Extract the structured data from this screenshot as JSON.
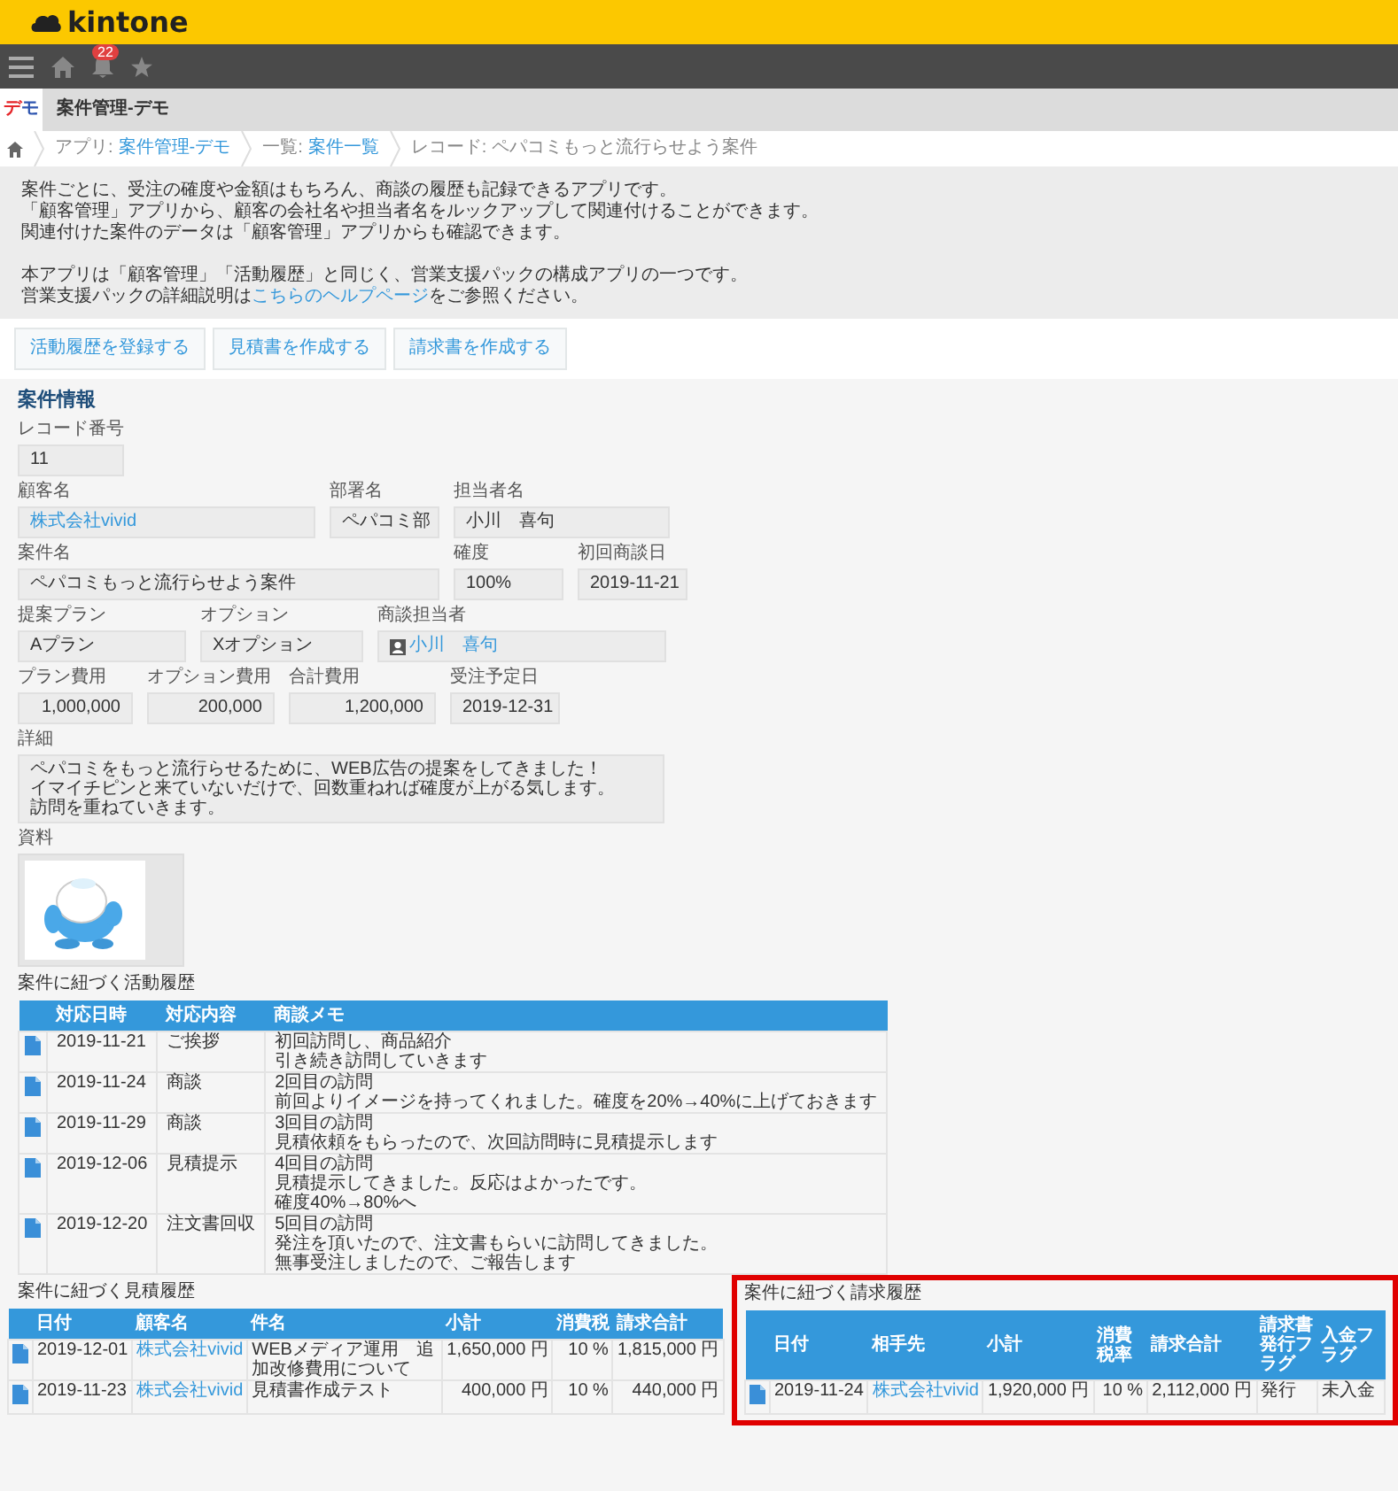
{
  "header": {
    "logo": "kintone"
  },
  "nav": {
    "notification_count": "22"
  },
  "app": {
    "badge": [
      {
        "text": "デ",
        "color": "#e5262a"
      },
      {
        "text": "モ",
        "color": "#2f56b0"
      }
    ],
    "title": "案件管理-デモ"
  },
  "breadcrumb": [
    {
      "kind": "link",
      "prefix": "アプリ:",
      "link": "案件管理-デモ"
    },
    {
      "kind": "link",
      "prefix": "一覧:",
      "link": "案件一覧"
    },
    {
      "kind": "current",
      "text": "レコード: ペパコミもっと流行らせよう案件"
    }
  ],
  "description": {
    "paragraphs": [
      [
        {
          "text": "案件ごとに、受注の確度や金額はもちろん、商談の履歴も記録できるアプリです。"
        },
        {
          "text": "「顧客管理」アプリから、顧客の会社名や担当者名をルックアップして関連付けることができます。"
        },
        {
          "text": "関連付けた案件のデータは「顧客管理」アプリからも確認できます。"
        }
      ],
      [
        {
          "text": "本アプリは「顧客管理」「活動履歴」と同じく、営業支援パックの構成アプリの一つです。"
        },
        {
          "text": "営業支援パックの詳細説明は",
          "link": "こちらのヘルプページ",
          "after": "をご参照ください。"
        }
      ]
    ]
  },
  "actions": [
    "活動履歴を登録する",
    "見積書を作成する",
    "請求書を作成する"
  ],
  "record": {
    "title": "案件情報",
    "groups": [
      {
        "fields": [
          {
            "label": "レコード番号",
            "value": "11",
            "kind": "text"
          }
        ]
      },
      {
        "fields": [
          {
            "label": "顧客名",
            "value": "株式会社vivid",
            "kind": "link"
          },
          {
            "label": "部署名",
            "value": "ペパコミ部",
            "kind": "text"
          },
          {
            "label": "担当者名",
            "value": "小川　喜句",
            "kind": "text"
          }
        ]
      },
      {
        "fields": [
          {
            "label": "案件名",
            "value": "ペパコミもっと流行らせよう案件",
            "kind": "text"
          },
          {
            "label": "確度",
            "value": "100%",
            "kind": "text"
          },
          {
            "label": "初回商談日",
            "value": "2019-11-21",
            "kind": "text"
          }
        ]
      },
      {
        "fields": [
          {
            "label": "提案プラン",
            "value": "Aプラン",
            "kind": "text"
          },
          {
            "label": "オプション",
            "value": "Xオプション",
            "kind": "text"
          },
          {
            "label": "商談担当者",
            "value": "小川　喜句",
            "kind": "user"
          }
        ]
      },
      {
        "fields": [
          {
            "label": "プラン費用",
            "value": "1,000,000",
            "kind": "number"
          },
          {
            "label": "オプション費用",
            "value": "200,000",
            "kind": "number"
          },
          {
            "label": "合計費用",
            "value": "1,200,000",
            "kind": "number"
          },
          {
            "label": "受注予定日",
            "value": "2019-12-31",
            "kind": "text"
          }
        ]
      },
      {
        "fields": [
          {
            "label": "詳細",
            "lines": [
              "ペパコミをもっと流行らせるために、WEB広告の提案をしてきました！",
              "イマイチピンと来ていないだけで、回数重ねれば確度が上がる気します。",
              "訪問を重ねていきます。"
            ],
            "kind": "multiline"
          }
        ]
      },
      {
        "fields": [
          {
            "label": "資料",
            "kind": "picture"
          }
        ]
      }
    ]
  },
  "activity_history": {
    "title": "案件に紐づく活動履歴",
    "columns": [
      {
        "label": "対応日時",
        "kind": "text"
      },
      {
        "label": "対応内容",
        "kind": "text"
      },
      {
        "label": "商談メモ",
        "kind": "memo"
      }
    ],
    "rows": [
      [
        "2019-11-21",
        "ご挨拶",
        [
          "初回訪問し、商品紹介",
          "引き続き訪問していきます"
        ]
      ],
      [
        "2019-11-24",
        "商談",
        [
          "2回目の訪問",
          "前回よりイメージを持ってくれました。確度を20%→40%に上げておきます"
        ]
      ],
      [
        "2019-11-29",
        "商談",
        [
          "3回目の訪問",
          "見積依頼をもらったので、次回訪問時に見積提示します"
        ]
      ],
      [
        "2019-12-06",
        "見積提示",
        [
          "4回目の訪問",
          "見積提示してきました。反応はよかったです。",
          "確度40%→80%へ"
        ]
      ],
      [
        "2019-12-20",
        "注文書回収",
        [
          "5回目の訪問",
          "発注を頂いたので、注文書もらいに訪問してきました。",
          "無事受注しましたので、ご報告します"
        ]
      ]
    ]
  },
  "quote_history": {
    "title": "案件に紐づく見積履歴",
    "columns": [
      {
        "label": "日付",
        "kind": "text"
      },
      {
        "label": "顧客名",
        "kind": "link"
      },
      {
        "label": "件名",
        "kind": "wrap"
      },
      {
        "label": "小計",
        "kind": "number"
      },
      {
        "label": "消費税",
        "kind": "number"
      },
      {
        "label": "請求合計",
        "kind": "number"
      }
    ],
    "rows": [
      [
        "2019-12-01",
        "株式会社vivid",
        "WEBメディア運用　追加改修費用について",
        "1,650,000 円",
        "10 %",
        "1,815,000 円"
      ],
      [
        "2019-11-23",
        "株式会社vivid",
        "見積書作成テスト",
        "400,000 円",
        "10 %",
        "440,000 円"
      ]
    ]
  },
  "invoice_history": {
    "title": "案件に紐づく請求履歴",
    "highlighted": true,
    "columns": [
      {
        "label": "日付",
        "kind": "text"
      },
      {
        "label": "相手先",
        "kind": "link"
      },
      {
        "label": "小計",
        "kind": "number"
      },
      {
        "label": "消費税率",
        "kind": "number"
      },
      {
        "label": "請求合計",
        "kind": "number"
      },
      {
        "label": "請求書発行フラグ",
        "kind": "text"
      },
      {
        "label": "入金フラグ",
        "kind": "text"
      }
    ],
    "rows": [
      [
        "2019-11-24",
        "株式会社vivid",
        "1,920,000 円",
        "10 %",
        "2,112,000 円",
        "発行",
        "未入金"
      ]
    ]
  }
}
